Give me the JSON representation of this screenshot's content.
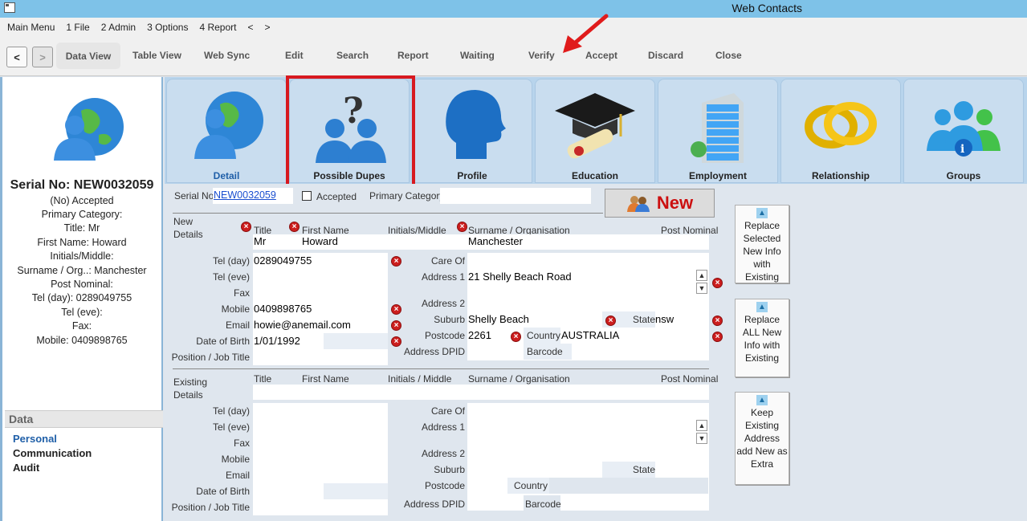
{
  "window": {
    "title": "Web Contacts"
  },
  "menu": [
    "Main Menu",
    "1 File",
    "2 Admin",
    "3 Options",
    "4 Report",
    "<",
    ">"
  ],
  "toolbar": {
    "back": "<",
    "forward": ">",
    "data_view": "Data View",
    "table_view": "Table View",
    "web_sync": "Web Sync",
    "edit": "Edit",
    "search": "Search",
    "report": "Report",
    "waiting": "Waiting",
    "verify": "Verify",
    "accept": "Accept",
    "discard": "Discard",
    "close": "Close"
  },
  "sidebar": {
    "serial": "Serial No: NEW0032059",
    "lines": [
      "(No) Accepted",
      "Primary Category:",
      "Title: Mr",
      "First Name: Howard",
      "Initials/Middle:",
      "Surname / Org..: Manchester",
      "Post Nominal:",
      "Tel (day): 0289049755",
      "Tel (eve):",
      "Fax:",
      "Mobile: 0409898765"
    ],
    "data_header": "Data",
    "links": [
      "Personal",
      "Communication",
      "Audit"
    ]
  },
  "tabs": [
    "Detail",
    "Possible Dupes",
    "Profile",
    "Education",
    "Employment",
    "Relationship",
    "Groups"
  ],
  "header": {
    "serial_label": "Serial No",
    "serial_value": "NEW0032059",
    "accepted_label": "Accepted",
    "primary_category_label": "Primary Category",
    "new_button": "New"
  },
  "new_details": {
    "section": "New Details",
    "title_label": "Title",
    "title": "Mr",
    "first_name_label": "First Name",
    "first_name": "Howard",
    "initials_label": "Initials/Middle",
    "surname_label": "Surname / Organisation",
    "surname": "Manchester",
    "post_nominal_label": "Post Nominal",
    "tel_day_label": "Tel (day)",
    "tel_day": "0289049755",
    "tel_eve_label": "Tel (eve)",
    "fax_label": "Fax",
    "mobile_label": "Mobile",
    "mobile": "0409898765",
    "email_label": "Email",
    "email": "howie@anemail.com",
    "dob_label": "Date of Birth",
    "dob": "1/01/1992",
    "position_label": "Position / Job Title",
    "care_of_label": "Care Of",
    "address1_label": "Address 1",
    "address1": "21 Shelly Beach Road",
    "address2_label": "Address 2",
    "suburb_label": "Suburb",
    "suburb": "Shelly Beach",
    "state_label": "State",
    "state": "nsw",
    "postcode_label": "Postcode",
    "postcode": "2261",
    "country_label": "Country",
    "country": "AUSTRALIA",
    "dpid_label": "Address DPID",
    "barcode_label": "Barcode"
  },
  "existing_details": {
    "section": "Existing Details",
    "title_label": "Title",
    "first_name_label": "First Name",
    "initials_label": "Initials / Middle",
    "surname_label": "Surname / Organisation",
    "post_nominal_label": "Post Nominal",
    "tel_day_label": "Tel (day)",
    "tel_eve_label": "Tel (eve)",
    "fax_label": "Fax",
    "mobile_label": "Mobile",
    "email_label": "Email",
    "dob_label": "Date of Birth",
    "position_label": "Position / Job Title",
    "care_of_label": "Care Of",
    "address1_label": "Address 1",
    "address2_label": "Address 2",
    "suburb_label": "Suburb",
    "state_label": "State",
    "postcode_label": "Postcode",
    "country_label": "Country",
    "dpid_label": "Address DPID",
    "barcode_label": "Barcode"
  },
  "actions": {
    "replace_selected": "Replace Selected New Info with Existing",
    "replace_all": "Replace ALL New Info with Existing",
    "keep_existing": "Keep Existing Address add New as Extra"
  },
  "colors": {
    "accent": "#7ec2e8",
    "highlight": "#d71920",
    "new_text": "#cc1010"
  }
}
